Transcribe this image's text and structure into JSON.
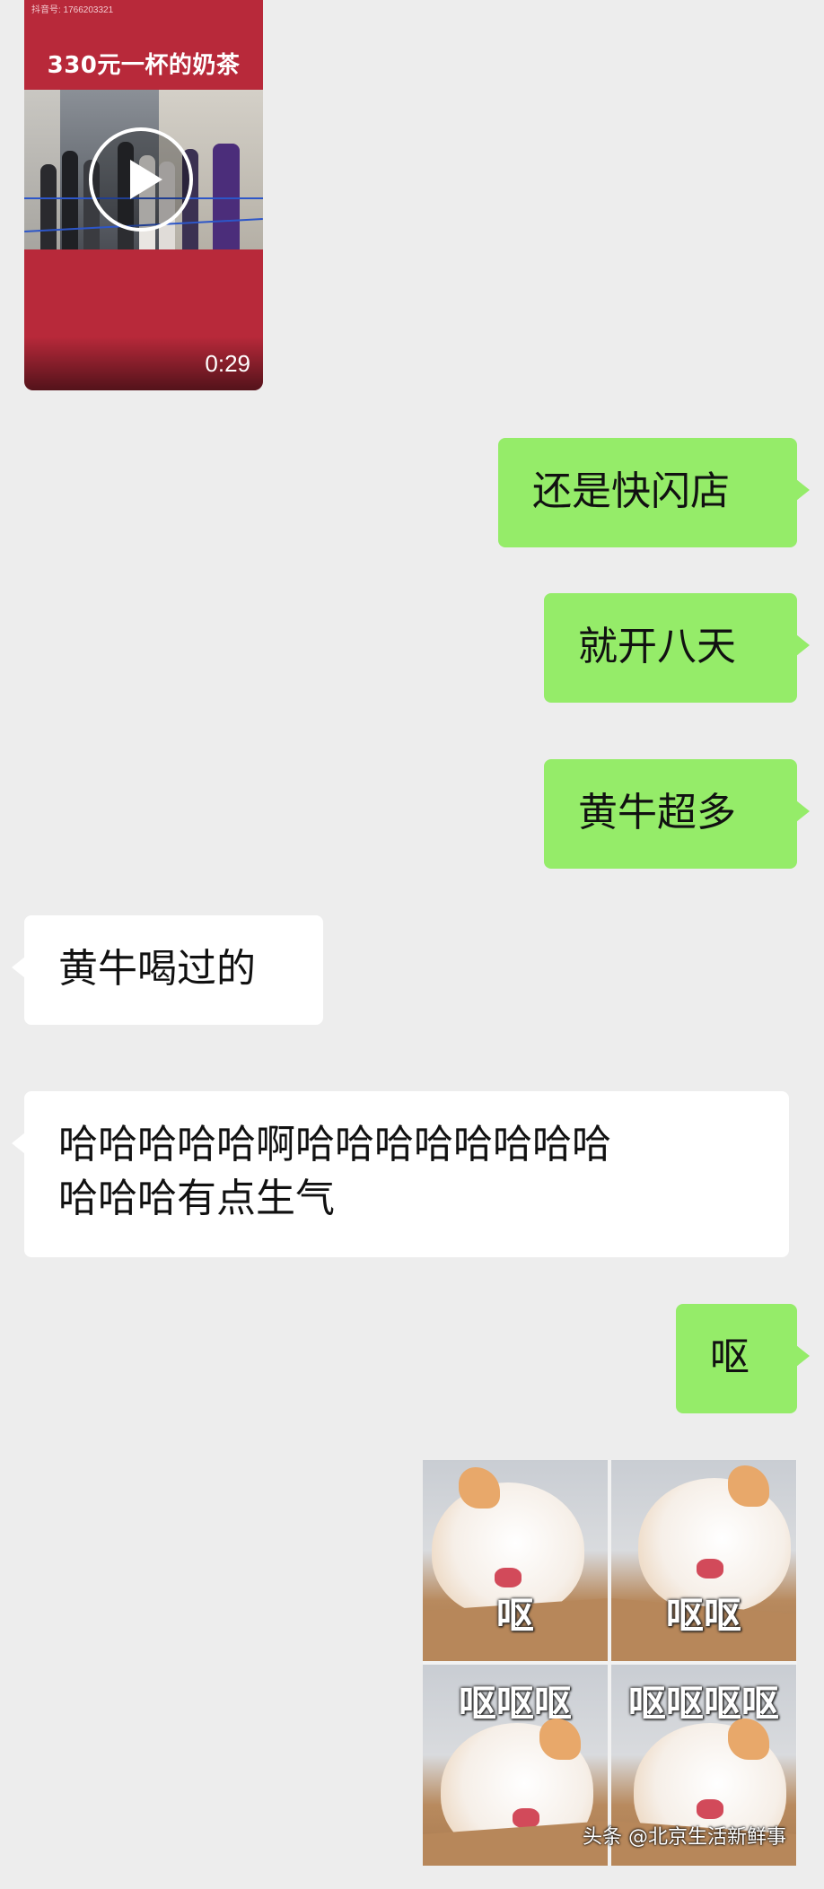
{
  "video": {
    "account_id": "抖音号: 1766203321",
    "title": "330元一杯的奶茶",
    "duration": "0:29"
  },
  "messages": [
    {
      "side": "right",
      "text": "还是快闪店"
    },
    {
      "side": "right",
      "text": "就开八天"
    },
    {
      "side": "right",
      "text": "黄牛超多"
    },
    {
      "side": "left",
      "text": "黄牛喝过的"
    },
    {
      "side": "left",
      "line1": "哈哈哈哈哈啊哈哈哈哈哈哈哈哈",
      "line2": "哈哈哈有点生气"
    },
    {
      "side": "right",
      "text": "呕"
    }
  ],
  "sticker": {
    "captions": [
      "呕",
      "呕呕",
      "呕呕呕",
      "呕呕呕呕"
    ]
  },
  "watermark": "头条 @北京生活新鲜事",
  "colors": {
    "background": "#ededed",
    "sent_bubble": "#95ec69",
    "received_bubble": "#ffffff",
    "video_card": "#b8293a"
  }
}
